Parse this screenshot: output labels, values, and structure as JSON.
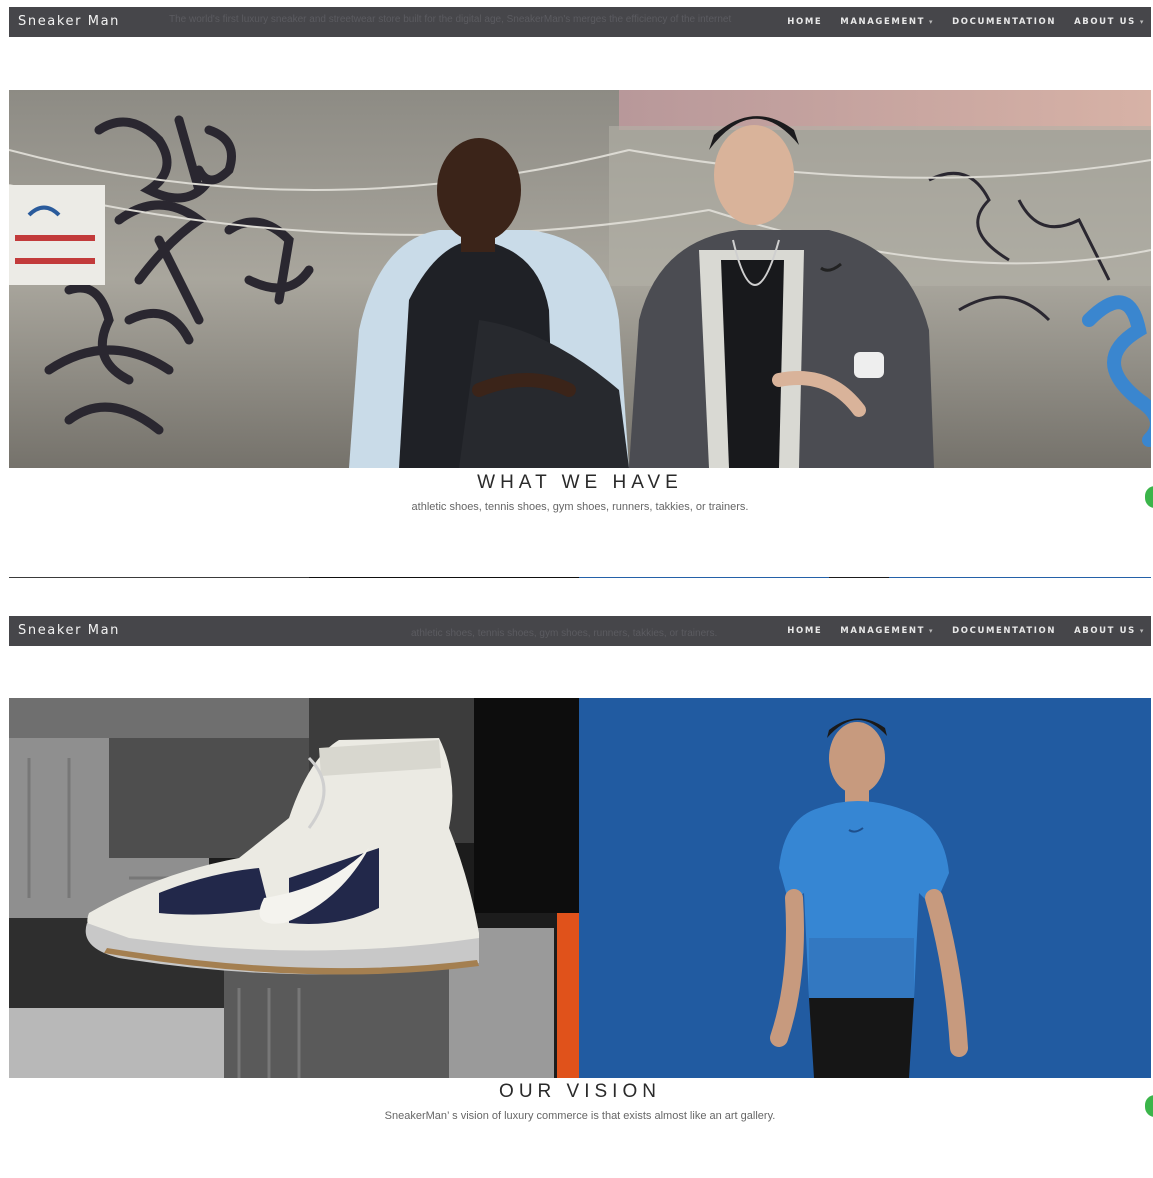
{
  "navbar": {
    "brand": "Sneaker Man",
    "menu": [
      {
        "label": "HOME",
        "dropdown": false
      },
      {
        "label": "MANAGEMENT",
        "dropdown": true
      },
      {
        "label": "DOCUMENTATION",
        "dropdown": false
      },
      {
        "label": "ABOUT US",
        "dropdown": true
      }
    ]
  },
  "screens": [
    {
      "ghost_text": "The world's first luxury sneaker and streetwear store built for the digital age, SneakerMan's merges the efficiency of the internet",
      "section_title": "WHAT WE HAVE",
      "section_subtitle": "athletic shoes, tennis shoes, gym shoes, runners, takkies, or trainers."
    },
    {
      "ghost_text": "athletic shoes, tennis shoes, gym shoes, runners, takkies, or trainers.",
      "section_title": "OUR VISION",
      "section_subtitle": "SneakerMan’ s vision of luxury commerce is that exists almost like an art gallery."
    }
  ],
  "colors": {
    "navbar_bg": "#46464a",
    "accent_blue": "#2461a8",
    "accent_orange": "#e0521b",
    "floating_tab": "#3bb54a"
  },
  "icons": [
    "chevron-down-icon",
    "swoosh-logo-icon"
  ]
}
